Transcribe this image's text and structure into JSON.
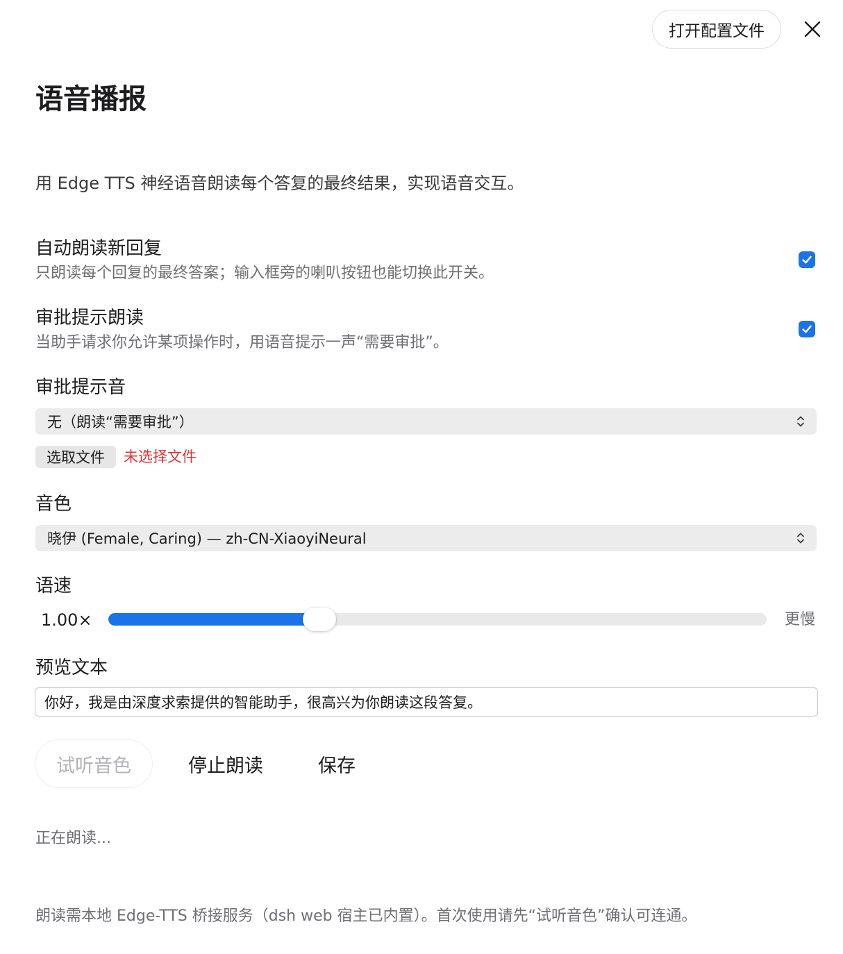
{
  "header": {
    "open_config_label": "打开配置文件",
    "close_icon": "close-icon"
  },
  "page": {
    "title": "语音播报",
    "description": "用 Edge TTS 神经语音朗读每个答复的最终结果，实现语音交互。"
  },
  "auto_read": {
    "title": "自动朗读新回复",
    "subtitle": "只朗读每个回复的最终答案；输入框旁的喇叭按钮也能切换此开关。",
    "checked": true
  },
  "approval_read": {
    "title": "审批提示朗读",
    "subtitle": "当助手请求你允许某项操作时，用语音提示一声“需要审批”。",
    "checked": true
  },
  "approval_sound": {
    "label": "审批提示音",
    "selected": "无（朗读“需要审批”）",
    "file_button_label": "选取文件",
    "file_status": "未选择文件"
  },
  "voice": {
    "label": "音色",
    "selected": "晓伊 (Female, Caring) — zh-CN-XiaoyiNeural"
  },
  "speed": {
    "label": "语速",
    "value_text": "1.00×",
    "fill_fraction": 0.32,
    "end_label": "更慢"
  },
  "preview": {
    "label": "预览文本",
    "value": "你好，我是由深度求索提供的智能助手，很高兴为你朗读这段答复。"
  },
  "actions": {
    "preview_label": "试听音色",
    "stop_label": "停止朗读",
    "save_label": "保存"
  },
  "status": {
    "text": "正在朗读..."
  },
  "footer": {
    "note": "朗读需本地 Edge-TTS 桥接服务（dsh web 宿主已内置）。首次使用请先“试听音色”确认可连通。"
  },
  "colors": {
    "accent": "#1a73e8",
    "error": "#e03131",
    "muted_text": "#6e6e73"
  }
}
